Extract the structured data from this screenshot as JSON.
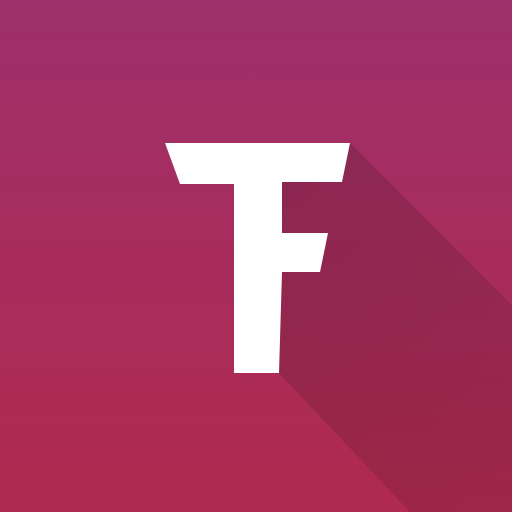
{
  "icon": {
    "name": "tf-app-icon",
    "logo_lettering": "TF",
    "colors": {
      "gradient_top": "#9e2f6a",
      "gradient_bottom": "#b02a4f",
      "glyph": "#ffffff",
      "shadow": "#000000"
    }
  }
}
